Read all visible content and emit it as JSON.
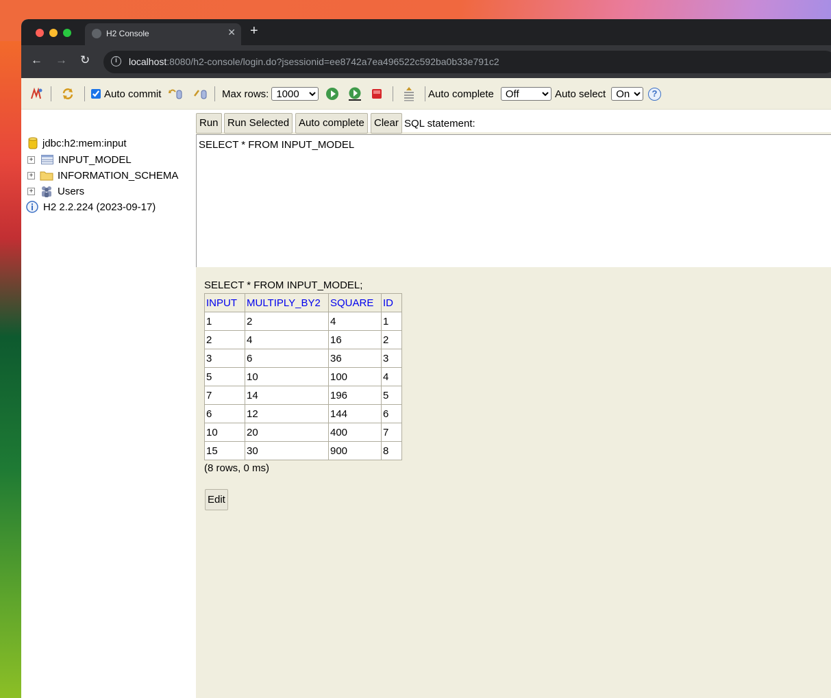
{
  "browser": {
    "tab_title": "H2 Console",
    "tab_close": "✕",
    "new_tab": "+",
    "back": "←",
    "forward": "→",
    "reload": "↻",
    "url_host": "localhost",
    "url_path": ":8080/h2-console/login.do?jsessionid=ee8742a7ea496522c592ba0b33e791c2"
  },
  "toolbar": {
    "auto_commit_label": "Auto commit",
    "auto_commit_checked": true,
    "max_rows_label": "Max rows:",
    "max_rows_value": "1000",
    "auto_complete_label": "Auto complete",
    "auto_complete_value": "Off",
    "auto_select_label": "Auto select",
    "auto_select_value": "On",
    "help": "?"
  },
  "sidebar": {
    "connection": "jdbc:h2:mem:input",
    "items": [
      {
        "label": "INPUT_MODEL",
        "icon": "table-icon"
      },
      {
        "label": "INFORMATION_SCHEMA",
        "icon": "folder-icon"
      },
      {
        "label": "Users",
        "icon": "users-icon"
      }
    ],
    "version": "H2 2.2.224 (2023-09-17)"
  },
  "commands": {
    "run": "Run",
    "run_selected": "Run Selected",
    "auto_complete": "Auto complete",
    "clear": "Clear",
    "sql_statement_label": "SQL statement:"
  },
  "editor": {
    "sql": "SELECT * FROM INPUT_MODEL"
  },
  "results": {
    "query": "SELECT * FROM INPUT_MODEL;",
    "columns": [
      "INPUT",
      "MULTIPLY_BY2",
      "SQUARE",
      "ID"
    ],
    "rows": [
      [
        "1",
        "2",
        "4",
        "1"
      ],
      [
        "2",
        "4",
        "16",
        "2"
      ],
      [
        "3",
        "6",
        "36",
        "3"
      ],
      [
        "5",
        "10",
        "100",
        "4"
      ],
      [
        "7",
        "14",
        "196",
        "5"
      ],
      [
        "6",
        "12",
        "144",
        "6"
      ],
      [
        "10",
        "20",
        "400",
        "7"
      ],
      [
        "15",
        "30",
        "900",
        "8"
      ]
    ],
    "summary": "(8 rows, 0 ms)",
    "edit_label": "Edit"
  }
}
